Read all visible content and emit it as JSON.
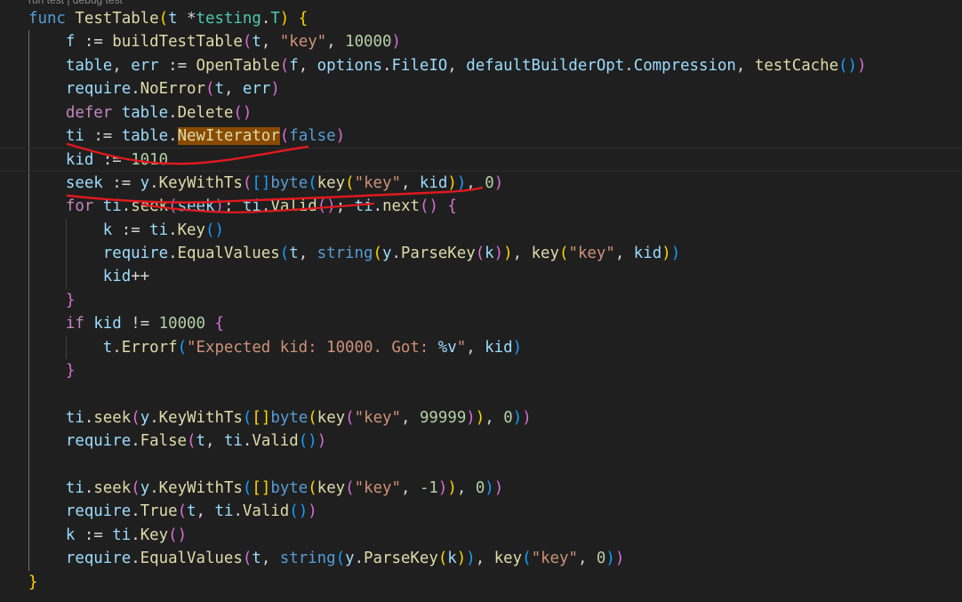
{
  "codelens": "run test | debug test",
  "lines": [
    [
      [
        "kw",
        "func"
      ],
      [
        "pu",
        " "
      ],
      [
        "fn",
        "TestTable"
      ],
      [
        "b1",
        "("
      ],
      [
        "vr",
        "t"
      ],
      [
        "pu",
        " *"
      ],
      [
        "ty",
        "testing"
      ],
      [
        "pu",
        "."
      ],
      [
        "ty",
        "T"
      ],
      [
        "b1",
        ")"
      ],
      [
        "pu",
        " "
      ],
      [
        "b1",
        "{"
      ]
    ],
    [
      [
        "pu",
        "    "
      ],
      [
        "vr",
        "f"
      ],
      [
        "pu",
        " := "
      ],
      [
        "fn",
        "buildTestTable"
      ],
      [
        "b2",
        "("
      ],
      [
        "vr",
        "t"
      ],
      [
        "pu",
        ", "
      ],
      [
        "st",
        "\"key\""
      ],
      [
        "pu",
        ", "
      ],
      [
        "nu",
        "10000"
      ],
      [
        "b2",
        ")"
      ]
    ],
    [
      [
        "pu",
        "    "
      ],
      [
        "vr",
        "table"
      ],
      [
        "pu",
        ", "
      ],
      [
        "vr",
        "err"
      ],
      [
        "pu",
        " := "
      ],
      [
        "fn",
        "OpenTable"
      ],
      [
        "b2",
        "("
      ],
      [
        "vr",
        "f"
      ],
      [
        "pu",
        ", "
      ],
      [
        "vr",
        "options"
      ],
      [
        "pu",
        "."
      ],
      [
        "vr",
        "FileIO"
      ],
      [
        "pu",
        ", "
      ],
      [
        "vr",
        "defaultBuilderOpt"
      ],
      [
        "pu",
        "."
      ],
      [
        "vr",
        "Compression"
      ],
      [
        "pu",
        ", "
      ],
      [
        "fn",
        "testCache"
      ],
      [
        "b3",
        "()"
      ],
      [
        "b2",
        ")"
      ]
    ],
    [
      [
        "pu",
        "    "
      ],
      [
        "vr",
        "require"
      ],
      [
        "pu",
        "."
      ],
      [
        "fn",
        "NoError"
      ],
      [
        "b2",
        "("
      ],
      [
        "vr",
        "t"
      ],
      [
        "pu",
        ", "
      ],
      [
        "vr",
        "err"
      ],
      [
        "b2",
        ")"
      ]
    ],
    [
      [
        "pu",
        "    "
      ],
      [
        "kwc",
        "defer"
      ],
      [
        "pu",
        " "
      ],
      [
        "vr",
        "table"
      ],
      [
        "pu",
        "."
      ],
      [
        "fn",
        "Delete"
      ],
      [
        "b2",
        "()"
      ]
    ],
    [
      [
        "pu",
        "    "
      ],
      [
        "vr",
        "ti"
      ],
      [
        "pu",
        " := "
      ],
      [
        "vr",
        "table"
      ],
      [
        "pu",
        "."
      ],
      [
        "fn hl",
        "NewIterator"
      ],
      [
        "b2",
        "("
      ],
      [
        "kw",
        "false"
      ],
      [
        "b2",
        ")"
      ]
    ],
    [
      [
        "pu",
        "    "
      ],
      [
        "vr",
        "kid"
      ],
      [
        "pu",
        " := "
      ],
      [
        "nu",
        "1010"
      ]
    ],
    [
      [
        "pu",
        "    "
      ],
      [
        "vr",
        "seek"
      ],
      [
        "pu",
        " := "
      ],
      [
        "vr",
        "y"
      ],
      [
        "pu",
        "."
      ],
      [
        "fn",
        "KeyWithTs"
      ],
      [
        "b2",
        "("
      ],
      [
        "b3",
        "[]"
      ],
      [
        "kw",
        "byte"
      ],
      [
        "b3",
        "("
      ],
      [
        "fn",
        "key"
      ],
      [
        "b1",
        "("
      ],
      [
        "st",
        "\"key\""
      ],
      [
        "pu",
        ", "
      ],
      [
        "vr",
        "kid"
      ],
      [
        "b1",
        ")"
      ],
      [
        "b3",
        ")"
      ],
      [
        "pu",
        ", "
      ],
      [
        "nu",
        "0"
      ],
      [
        "b2",
        ")"
      ]
    ],
    [
      [
        "pu",
        "    "
      ],
      [
        "kwc",
        "for"
      ],
      [
        "pu",
        " "
      ],
      [
        "vr",
        "ti"
      ],
      [
        "pu",
        "."
      ],
      [
        "fn",
        "seek"
      ],
      [
        "b2",
        "("
      ],
      [
        "vr",
        "seek"
      ],
      [
        "b2",
        ")"
      ],
      [
        "pu",
        "; "
      ],
      [
        "vr",
        "ti"
      ],
      [
        "pu",
        "."
      ],
      [
        "fn",
        "Valid"
      ],
      [
        "b2",
        "()"
      ],
      [
        "pu",
        "; "
      ],
      [
        "vr",
        "ti"
      ],
      [
        "pu",
        "."
      ],
      [
        "fn",
        "next"
      ],
      [
        "b2",
        "()"
      ],
      [
        "pu",
        " "
      ],
      [
        "b2",
        "{"
      ]
    ],
    [
      [
        "pu",
        "        "
      ],
      [
        "vr",
        "k"
      ],
      [
        "pu",
        " := "
      ],
      [
        "vr",
        "ti"
      ],
      [
        "pu",
        "."
      ],
      [
        "fn",
        "Key"
      ],
      [
        "b3",
        "()"
      ]
    ],
    [
      [
        "pu",
        "        "
      ],
      [
        "vr",
        "require"
      ],
      [
        "pu",
        "."
      ],
      [
        "fn",
        "EqualValues"
      ],
      [
        "b3",
        "("
      ],
      [
        "vr",
        "t"
      ],
      [
        "pu",
        ", "
      ],
      [
        "kw",
        "string"
      ],
      [
        "b1",
        "("
      ],
      [
        "vr",
        "y"
      ],
      [
        "pu",
        "."
      ],
      [
        "fn",
        "ParseKey"
      ],
      [
        "b2",
        "("
      ],
      [
        "vr",
        "k"
      ],
      [
        "b2",
        ")"
      ],
      [
        "b1",
        ")"
      ],
      [
        "pu",
        ", "
      ],
      [
        "fn",
        "key"
      ],
      [
        "b1",
        "("
      ],
      [
        "st",
        "\"key\""
      ],
      [
        "pu",
        ", "
      ],
      [
        "vr",
        "kid"
      ],
      [
        "b1",
        ")"
      ],
      [
        "b3",
        ")"
      ]
    ],
    [
      [
        "pu",
        "        "
      ],
      [
        "vr",
        "kid"
      ],
      [
        "pu",
        "++"
      ]
    ],
    [
      [
        "pu",
        "    "
      ],
      [
        "b2",
        "}"
      ]
    ],
    [
      [
        "pu",
        "    "
      ],
      [
        "kwc",
        "if"
      ],
      [
        "pu",
        " "
      ],
      [
        "vr",
        "kid"
      ],
      [
        "pu",
        " != "
      ],
      [
        "nu",
        "10000"
      ],
      [
        "pu",
        " "
      ],
      [
        "b2",
        "{"
      ]
    ],
    [
      [
        "pu",
        "        "
      ],
      [
        "vr",
        "t"
      ],
      [
        "pu",
        "."
      ],
      [
        "fn",
        "Errorf"
      ],
      [
        "b3",
        "("
      ],
      [
        "st",
        "\"Expected kid: 10000. Got: "
      ],
      [
        "fmt",
        "%v"
      ],
      [
        "st",
        "\""
      ],
      [
        "pu",
        ", "
      ],
      [
        "vr",
        "kid"
      ],
      [
        "b3",
        ")"
      ]
    ],
    [
      [
        "pu",
        "    "
      ],
      [
        "b2",
        "}"
      ]
    ],
    [
      [
        "pu",
        ""
      ]
    ],
    [
      [
        "pu",
        "    "
      ],
      [
        "vr",
        "ti"
      ],
      [
        "pu",
        "."
      ],
      [
        "fn",
        "seek"
      ],
      [
        "b2",
        "("
      ],
      [
        "vr",
        "y"
      ],
      [
        "pu",
        "."
      ],
      [
        "fn",
        "KeyWithTs"
      ],
      [
        "b3",
        "("
      ],
      [
        "b1",
        "[]"
      ],
      [
        "kw",
        "byte"
      ],
      [
        "b1",
        "("
      ],
      [
        "fn",
        "key"
      ],
      [
        "b2",
        "("
      ],
      [
        "st",
        "\"key\""
      ],
      [
        "pu",
        ", "
      ],
      [
        "nu",
        "99999"
      ],
      [
        "b2",
        ")"
      ],
      [
        "b1",
        ")"
      ],
      [
        "pu",
        ", "
      ],
      [
        "nu",
        "0"
      ],
      [
        "b3",
        ")"
      ],
      [
        "b2",
        ")"
      ]
    ],
    [
      [
        "pu",
        "    "
      ],
      [
        "vr",
        "require"
      ],
      [
        "pu",
        "."
      ],
      [
        "fn",
        "False"
      ],
      [
        "b2",
        "("
      ],
      [
        "vr",
        "t"
      ],
      [
        "pu",
        ", "
      ],
      [
        "vr",
        "ti"
      ],
      [
        "pu",
        "."
      ],
      [
        "fn",
        "Valid"
      ],
      [
        "b3",
        "()"
      ],
      [
        "b2",
        ")"
      ]
    ],
    [
      [
        "pu",
        ""
      ]
    ],
    [
      [
        "pu",
        "    "
      ],
      [
        "vr",
        "ti"
      ],
      [
        "pu",
        "."
      ],
      [
        "fn",
        "seek"
      ],
      [
        "b2",
        "("
      ],
      [
        "vr",
        "y"
      ],
      [
        "pu",
        "."
      ],
      [
        "fn",
        "KeyWithTs"
      ],
      [
        "b3",
        "("
      ],
      [
        "b1",
        "[]"
      ],
      [
        "kw",
        "byte"
      ],
      [
        "b1",
        "("
      ],
      [
        "fn",
        "key"
      ],
      [
        "b2",
        "("
      ],
      [
        "st",
        "\"key\""
      ],
      [
        "pu",
        ", "
      ],
      [
        "nu",
        "-1"
      ],
      [
        "b2",
        ")"
      ],
      [
        "b1",
        ")"
      ],
      [
        "pu",
        ", "
      ],
      [
        "nu",
        "0"
      ],
      [
        "b3",
        ")"
      ],
      [
        "b2",
        ")"
      ]
    ],
    [
      [
        "pu",
        "    "
      ],
      [
        "vr",
        "require"
      ],
      [
        "pu",
        "."
      ],
      [
        "fn",
        "True"
      ],
      [
        "b2",
        "("
      ],
      [
        "vr",
        "t"
      ],
      [
        "pu",
        ", "
      ],
      [
        "vr",
        "ti"
      ],
      [
        "pu",
        "."
      ],
      [
        "fn",
        "Valid"
      ],
      [
        "b3",
        "()"
      ],
      [
        "b2",
        ")"
      ]
    ],
    [
      [
        "pu",
        "    "
      ],
      [
        "vr",
        "k"
      ],
      [
        "pu",
        " := "
      ],
      [
        "vr",
        "ti"
      ],
      [
        "pu",
        "."
      ],
      [
        "fn",
        "Key"
      ],
      [
        "b2",
        "()"
      ]
    ],
    [
      [
        "pu",
        "    "
      ],
      [
        "vr",
        "require"
      ],
      [
        "pu",
        "."
      ],
      [
        "fn",
        "EqualValues"
      ],
      [
        "b2",
        "("
      ],
      [
        "vr",
        "t"
      ],
      [
        "pu",
        ", "
      ],
      [
        "kw",
        "string"
      ],
      [
        "b3",
        "("
      ],
      [
        "vr",
        "y"
      ],
      [
        "pu",
        "."
      ],
      [
        "fn",
        "ParseKey"
      ],
      [
        "b1",
        "("
      ],
      [
        "vr",
        "k"
      ],
      [
        "b1",
        ")"
      ],
      [
        "b3",
        ")"
      ],
      [
        "pu",
        ", "
      ],
      [
        "fn",
        "key"
      ],
      [
        "b3",
        "("
      ],
      [
        "st",
        "\"key\""
      ],
      [
        "pu",
        ", "
      ],
      [
        "nu",
        "0"
      ],
      [
        "b3",
        ")"
      ],
      [
        "b2",
        ")"
      ]
    ],
    [
      [
        "b1",
        "}"
      ]
    ]
  ],
  "colors": {
    "background": "#1f1f1f",
    "highlight": "#8a4a00",
    "scribble": "#e0191e"
  }
}
